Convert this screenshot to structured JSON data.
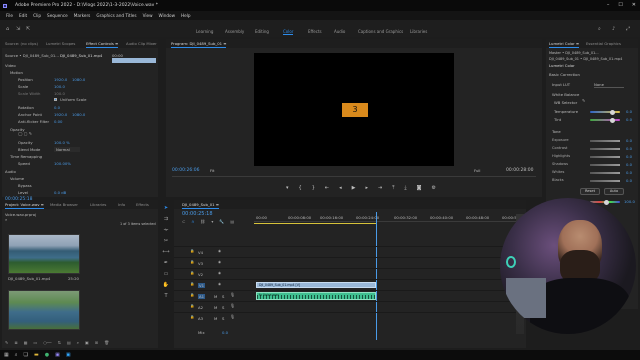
{
  "window": {
    "title": "Adobe Premiere Pro 2022 - D:\\Vlogs 2022\\1-3-2022\\Voice.wav *",
    "controls": [
      "–",
      "☐",
      "✕"
    ]
  },
  "menu": [
    "File",
    "Edit",
    "Clip",
    "Sequence",
    "Markers",
    "Graphics and Titles",
    "View",
    "Window",
    "Help"
  ],
  "workspaces": [
    "Learning",
    "Assembly",
    "Editing",
    "Color",
    "Effects",
    "Audio",
    "Captions and Graphics",
    "Libraries"
  ],
  "active_workspace": "Color",
  "source_panel": {
    "tabs": [
      "Source: (no clips)",
      "Lumetri Scopes",
      "Effect Controls ≡",
      "Audio Clip Mixer"
    ],
    "header": "Source • DJI_0489_Sub_01...",
    "clip_name": "DJI_0489_Sub_01.mp4",
    "seq_time": "00:00",
    "sections": {
      "video": "Video",
      "motion": "Motion",
      "position": "Position",
      "position_x": "1920.0",
      "position_y": "1080.0",
      "scale": "Scale",
      "scale_val": "100.0",
      "scale_width": "Scale Width",
      "scale_width_val": "100.0",
      "uniform_scale": "Uniform Scale",
      "rotation": "Rotation",
      "rotation_val": "0.0",
      "anchor": "Anchor Point",
      "anchor_x": "1920.0",
      "anchor_y": "1080.0",
      "flicker": "Anti-flicker Filter",
      "flicker_val": "0.00",
      "opacity_group": "Opacity",
      "opacity": "Opacity",
      "opacity_val": "100.0 %",
      "blend": "Blend Mode",
      "blend_val": "Normal",
      "time_remap": "Time Remapping",
      "speed": "Speed",
      "speed_val": "100.00%",
      "audio": "Audio",
      "volume": "Volume",
      "bypass": "Bypass",
      "level": "Level",
      "level_val": "0.0 dB"
    },
    "timecode": "00:00:25:18"
  },
  "program_panel": {
    "title": "Program: DJI_0489_Sub_01 ≡",
    "timecode_left": "00:00:26:06",
    "fit": "Fit",
    "full": "Full",
    "timecode_right": "00:00:28:00",
    "countdown": "3"
  },
  "project_panel": {
    "tabs": [
      "Project: Voice.wav ≡",
      "Media Browser",
      "Libraries",
      "Info",
      "Effects"
    ],
    "file": "Voice.wav.prproj",
    "selection": "1 of 3 items selected",
    "items": [
      {
        "name": "DJI_0489_Sub_01.mp4",
        "duration": "25:20"
      },
      {
        "name": "DJI_0489_Sub_01.mp4",
        "duration": ""
      }
    ]
  },
  "timeline": {
    "title": "DJI_0489_Sub_01 ≡",
    "timecode": "00:00:25:18",
    "ruler": [
      "00:00",
      "00:00:08:00",
      "00:00:16:00",
      "00:00:24:00",
      "00:00:32:00",
      "00:00:40:00",
      "00:00:48:00",
      "00:00:56:00"
    ],
    "tracks_video": [
      "V4",
      "V3",
      "V2",
      "V1"
    ],
    "tracks_audio": [
      "A1",
      "A2",
      "A3"
    ],
    "mix": "Mix",
    "mix_val": "0.0",
    "video_clip": "DJI_0489_Sub_01.mp4 [V]",
    "audio_clip": "fx Voice.wav"
  },
  "lumetri": {
    "tabs": [
      "Lumetri Color ≡",
      "Essential Graphics"
    ],
    "master": "Master • DJI_0489_Sub_01...",
    "source_line": "DJI_0489_Sub_01 • DJI_0489_Sub_01.mp4",
    "section": "Lumetri Color",
    "basic": "Basic Correction",
    "input_lut": "Input LUT",
    "input_lut_val": "None",
    "white_balance": "White Balance",
    "wb_selector": "WB Selector",
    "temperature": "Temperature",
    "tint": "Tint",
    "tone": "Tone",
    "rows": [
      {
        "label": "Exposure",
        "value": "0.0"
      },
      {
        "label": "Contrast",
        "value": "0.0"
      },
      {
        "label": "Highlights",
        "value": "0.0"
      },
      {
        "label": "Shadows",
        "value": "0.0"
      },
      {
        "label": "Whites",
        "value": "0.0"
      },
      {
        "label": "Blacks",
        "value": "0.0"
      }
    ],
    "temp_val": "0.0",
    "tint_val": "0.0",
    "reset": "Reset",
    "auto": "Auto",
    "saturation": "Saturation",
    "saturation_val": "100.0",
    "creative": "Creative",
    "curves": "Curves",
    "color_wheels": "Color Wheels & Match",
    "hsl": "HSL Secondary",
    "vignette": "Vignette"
  },
  "colors": {
    "accent": "#2d8ceb",
    "value_blue": "#4a9be8",
    "audio_clip": "#3fbf90",
    "video_clip": "#9ab8d8",
    "countdown_bg": "#d98a1c"
  }
}
